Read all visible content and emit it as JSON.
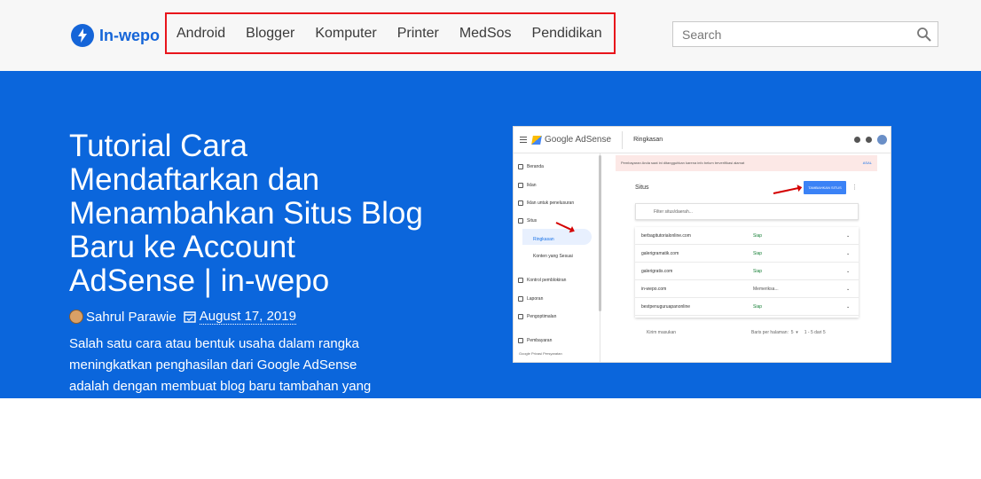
{
  "brand": {
    "name": "In-wepo",
    "color": "#1565d8"
  },
  "nav": {
    "items": [
      {
        "label": "Android"
      },
      {
        "label": "Blogger"
      },
      {
        "label": "Komputer"
      },
      {
        "label": "Printer"
      },
      {
        "label": "MedSos"
      },
      {
        "label": "Pendidikan"
      }
    ],
    "highlight_color": "#e8141b"
  },
  "search": {
    "placeholder": "Search",
    "icon": "search-icon"
  },
  "hero": {
    "background": "#0b66dc",
    "title": "Tutorial Cara Mendaftarkan dan Menambahkan Situs Blog Baru ke Account AdSense | in-wepo",
    "author": "Sahrul Parawie",
    "date": "August 17, 2019",
    "excerpt": "Salah satu cara atau bentuk usaha dalam rangka meningkatkan penghasilan dari Google AdSense adalah dengan membuat blog baru tambahan yang"
  },
  "screenshot": {
    "brand": "Google AdSense",
    "page": "Ringkasan",
    "alert": "Pembayaran Anda saat ini ditangguhkan karena info belum terverifikasi alamat",
    "alert_link": "ASAL",
    "sidebar": [
      {
        "label": "Beranda"
      },
      {
        "label": "Iklan"
      },
      {
        "label": "Iklan untuk penelusuran"
      },
      {
        "label": "Situs"
      },
      {
        "label": "Ringkasan"
      },
      {
        "label": "Konten yang Sesuai"
      },
      {
        "label": "Kontrol pemblokiran"
      },
      {
        "label": "Laporan"
      },
      {
        "label": "Pengoptimalan"
      },
      {
        "label": "Pembayaran"
      }
    ],
    "sidebar_footer": "Google  Privasi  Persyaratan",
    "section_title": "Situs",
    "add_button": "TAMBAHKAN SITUS",
    "filter_placeholder": "Filter situs/daerah...",
    "rows": [
      {
        "site": "berbagitutorialonline.com",
        "status": "Siap"
      },
      {
        "site": "galerigramatik.com",
        "status": "Siap"
      },
      {
        "site": "galerigratis.com",
        "status": "Siap"
      },
      {
        "site": "in-wepo.com",
        "status": "Memeriksa..."
      },
      {
        "site": "bestpenuguruapanonline",
        "status": "Siap"
      }
    ],
    "feedback": "Kirim masukan",
    "pagination": "Baris per halaman:  5  ▾     1 - 5 dari 5"
  }
}
